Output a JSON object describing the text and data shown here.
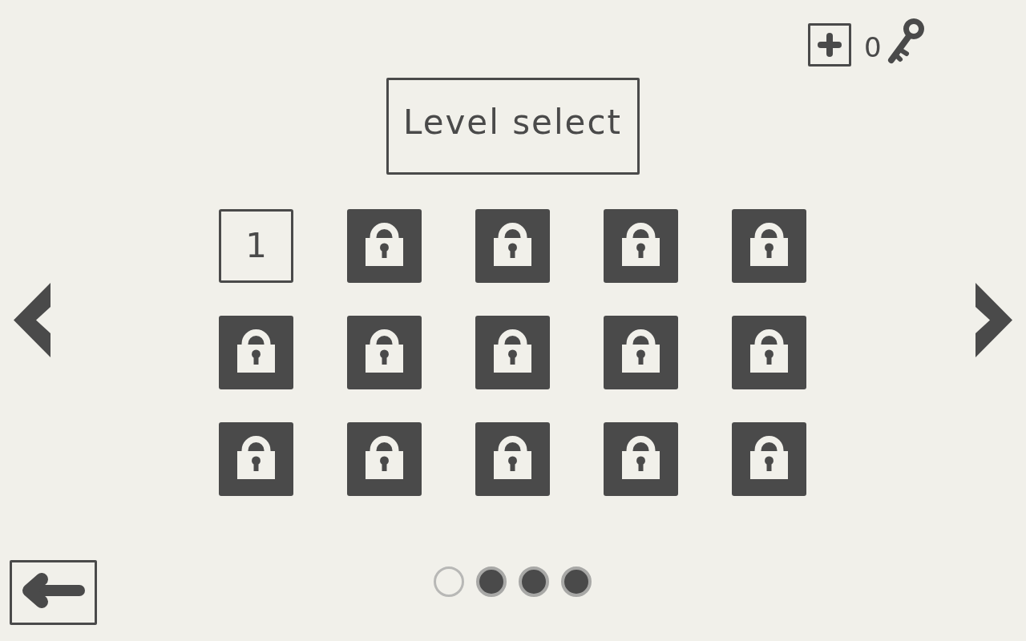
{
  "keys": {
    "count": "0"
  },
  "title": "Level select",
  "levels": [
    {
      "label": "1",
      "locked": false
    },
    {
      "locked": true
    },
    {
      "locked": true
    },
    {
      "locked": true
    },
    {
      "locked": true
    },
    {
      "locked": true
    },
    {
      "locked": true
    },
    {
      "locked": true
    },
    {
      "locked": true
    },
    {
      "locked": true
    },
    {
      "locked": true
    },
    {
      "locked": true
    },
    {
      "locked": true
    },
    {
      "locked": true
    },
    {
      "locked": true
    }
  ],
  "pages": [
    {
      "selected": true
    },
    {
      "selected": false
    },
    {
      "selected": false
    },
    {
      "selected": false
    }
  ]
}
